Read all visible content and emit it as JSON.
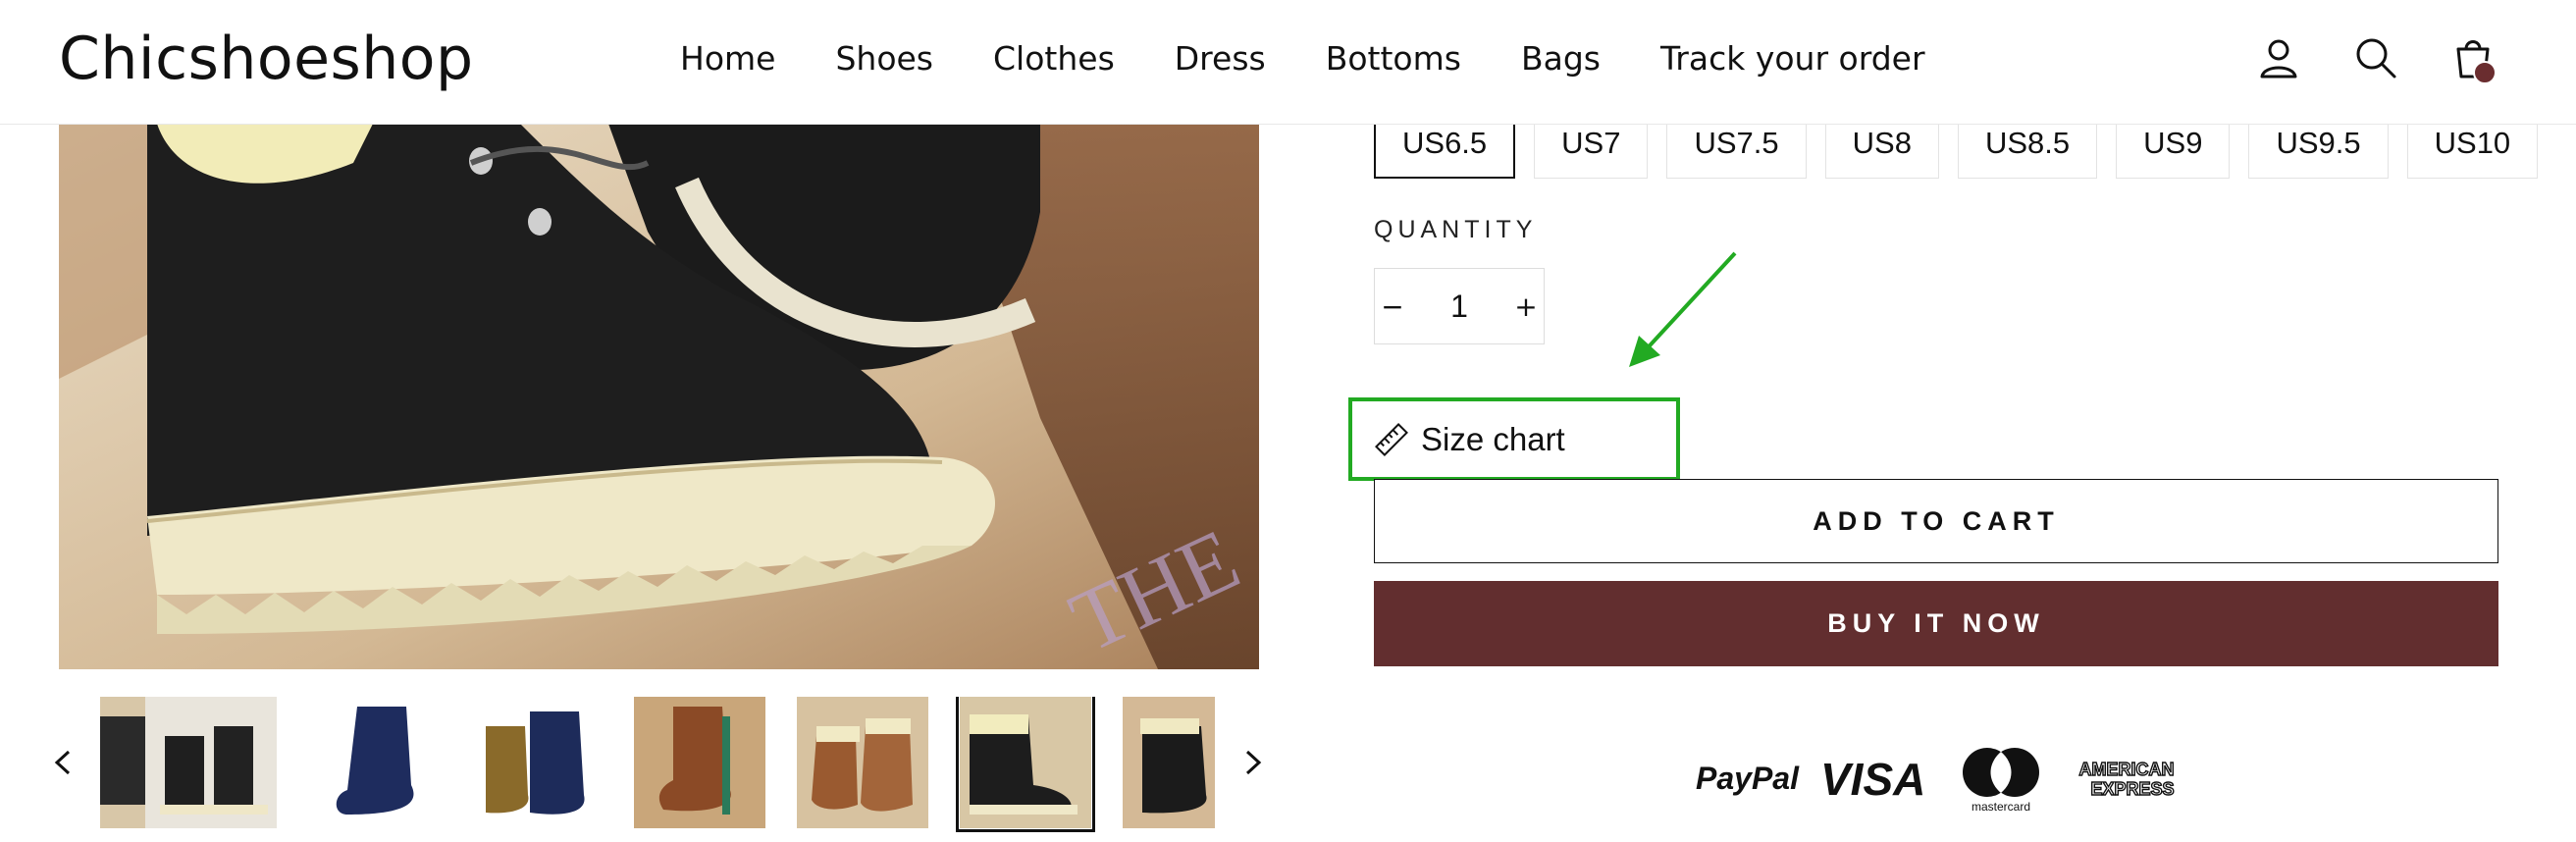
{
  "header": {
    "logo": "Chicshoeshop",
    "nav": [
      "Home",
      "Shoes",
      "Clothes",
      "Dress",
      "Bottoms",
      "Bags",
      "Track your order"
    ],
    "icons": [
      "account-icon",
      "search-icon",
      "cart-icon"
    ],
    "cart_badge_color": "#6a2d2f"
  },
  "product": {
    "sizes": [
      "US6.5",
      "US7",
      "US7.5",
      "US8",
      "US8.5",
      "US9",
      "US9.5",
      "US10"
    ],
    "selected_size": "US6.5",
    "quantity_label": "QUANTITY",
    "quantity": "1",
    "decrement": "−",
    "increment": "+",
    "size_chart_label": "Size chart",
    "add_to_cart": "ADD TO CART",
    "buy_it_now": "BUY IT NOW",
    "buy_color": "#622e2f",
    "highlight_color": "#22aa22"
  },
  "gallery": {
    "thumbnail_count": 8,
    "active_thumbnail": 6
  },
  "payments": {
    "paypal": "PayPal",
    "visa": "VISA",
    "mastercard": "mastercard",
    "amex_line1": "AMERICAN",
    "amex_line2": "EXPRESS"
  }
}
